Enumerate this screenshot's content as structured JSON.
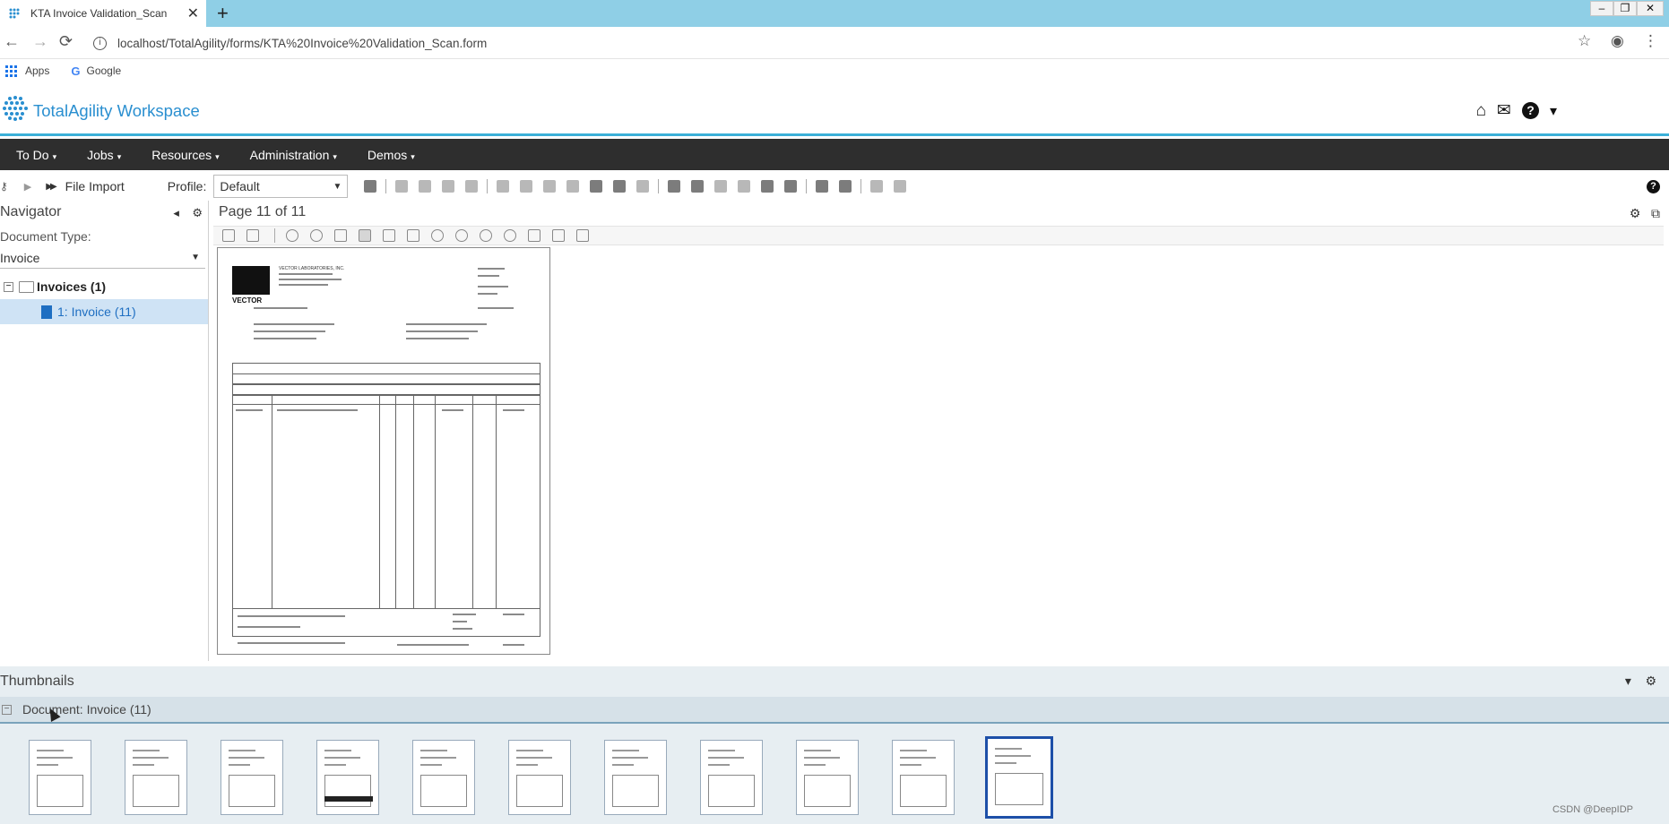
{
  "browser": {
    "tab_title": "KTA Invoice Validation_Scan",
    "tab_close": "✕",
    "new_tab": "+",
    "url": "localhost/TotalAgility/forms/KTA%20Invoice%20Validation_Scan.form",
    "bookmarks": [
      {
        "label": "Apps",
        "icon": "apps-grid-icon"
      },
      {
        "label": "Google",
        "icon": "google-g-icon"
      }
    ],
    "window_controls": {
      "minimize": "–",
      "restore": "❐",
      "close": "✕"
    },
    "nav_icons": {
      "back": "←",
      "forward": "→",
      "reload": "⟳",
      "star": "☆",
      "account": "◉",
      "menu": "⋮"
    }
  },
  "app": {
    "brand": "TotalAgility Workspace",
    "header_icons": [
      "home-icon",
      "mail-icon",
      "help-icon",
      "user-icon"
    ],
    "header_glyphs": {
      "home": "⌂",
      "mail": "✉",
      "help": "?",
      "user": "👤"
    },
    "accent_color": "#3bb0d8",
    "brand_color": "#2a8fd0"
  },
  "menu": {
    "items": [
      "To Do",
      "Jobs",
      "Resources",
      "Administration",
      "Demos"
    ],
    "caret": "▾"
  },
  "toolbar": {
    "file_import": "File Import",
    "profile_label": "Profile:",
    "profile_value": "Default",
    "play_glyph": "▶",
    "fast_forward_glyph": "▶▶",
    "help_glyph": "?"
  },
  "navigator": {
    "title": "Navigator",
    "collapse_glyph": "◂",
    "settings_glyph": "⚙",
    "document_type_label": "Document Type:",
    "document_type_value": "Invoice",
    "dropdown_glyph": "▾",
    "tree_root": "Invoices (1)",
    "tree_child": "1: Invoice (11)",
    "tree_toggle": "−"
  },
  "viewer": {
    "page_indicator": "Page 11 of 11",
    "settings_glyph": "⚙",
    "popout_glyph": "⧉",
    "document": {
      "vendor_logo_text": "VECTOR",
      "vendor_name": "VECTOR LABORATORIES, INC."
    }
  },
  "thumbnails": {
    "title": "Thumbnails",
    "group_label": "Document: Invoice (11)",
    "count": 11,
    "selected_index": 10,
    "collapse_glyph": "▾",
    "settings_glyph": "⚙",
    "group_toggle": "−",
    "selected_color": "#1d4fa8"
  },
  "watermark": "CSDN @DeepIDP"
}
